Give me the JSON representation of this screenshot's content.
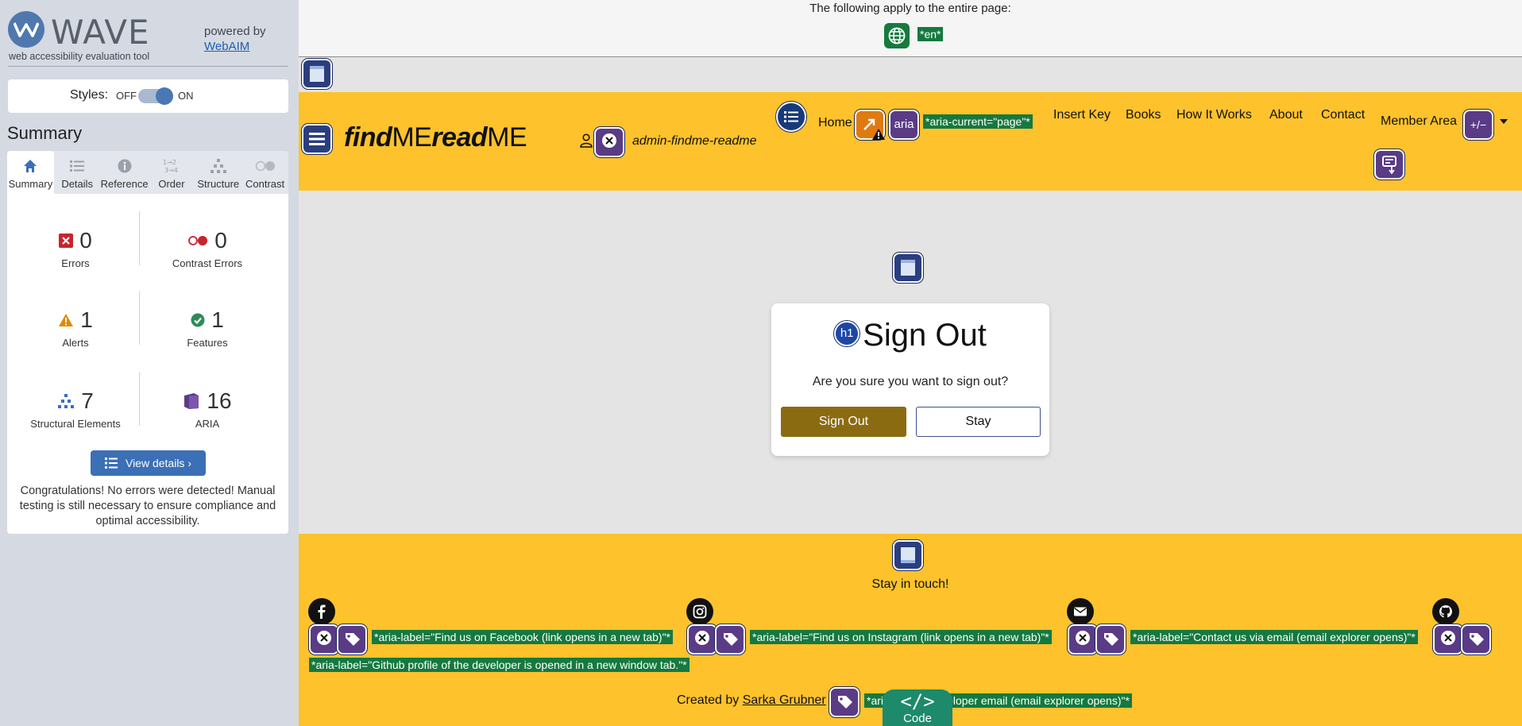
{
  "wave": {
    "title": "WAVE",
    "tagline": "web accessibility evaluation tool",
    "powered_by": "powered by",
    "webaim_link": "WebAIM",
    "styles_label": "Styles:",
    "styles_off": "OFF",
    "styles_on": "ON",
    "summary_title": "Summary",
    "tabs": [
      {
        "label": "Summary",
        "icon": "home-icon",
        "active": true
      },
      {
        "label": "Details",
        "icon": "list-icon",
        "active": false
      },
      {
        "label": "Reference",
        "icon": "info-icon",
        "active": false
      },
      {
        "label": "Order",
        "icon": "order-icon",
        "active": false
      },
      {
        "label": "Structure",
        "icon": "structure-icon",
        "active": false
      },
      {
        "label": "Contrast",
        "icon": "contrast-icon",
        "active": false
      }
    ],
    "stats": {
      "errors": {
        "count": "0",
        "label": "Errors",
        "color": "#c8242c"
      },
      "contrast_errors": {
        "count": "0",
        "label": "Contrast Errors",
        "color": "#c8242c"
      },
      "alerts": {
        "count": "1",
        "label": "Alerts",
        "color": "#e08a00"
      },
      "features": {
        "count": "1",
        "label": "Features",
        "color": "#2e8b57"
      },
      "structural": {
        "count": "7",
        "label": "Structural Elements",
        "color": "#3b6fb6"
      },
      "aria": {
        "count": "16",
        "label": "ARIA",
        "color": "#5a3b86"
      }
    },
    "view_details": "View details ›",
    "congrats": "Congratulations! No errors were detected! Manual testing is still necessary to ensure compliance and optimal accessibility."
  },
  "page": {
    "lang_notice": "The following apply to the entire page:",
    "lang_value": "*en*",
    "brand_find": "find",
    "brand_me1": "ME",
    "brand_read": "read",
    "brand_me2": "ME",
    "username": "admin-findme-readme",
    "nav": {
      "home": "Home",
      "aria_current": "*aria-current=\"page\"*",
      "insert_key": "Insert Key",
      "books": "Books",
      "how_it_works": "How It Works",
      "about": "About",
      "contact": "Contact",
      "member_area": "Member Area",
      "expand_badge": "+/−",
      "aria_badge": "aria"
    },
    "modal": {
      "h1_badge": "h1",
      "title": "Sign Out",
      "question": "Are you sure you want to sign out?",
      "sign_out": "Sign Out",
      "stay": "Stay"
    },
    "footer": {
      "stay_in_touch": "Stay in touch!",
      "facebook_label": "*aria-label=\"Find us on Facebook (link opens in a new tab)\"*",
      "instagram_label": "*aria-label=\"Find us on Instagram (link opens in a new tab)\"*",
      "email_label": "*aria-label=\"Contact us via email (email explorer opens)\"*",
      "github_label": "*aria-label=\"Github profile of the developer is opened in a new window tab.\"*",
      "created_by": "Created by",
      "author": "Sarka Grubner",
      "dev_email_label": "*aria-label=\"Developer email (email explorer opens)\"*",
      "code_tab": "Code"
    }
  }
}
